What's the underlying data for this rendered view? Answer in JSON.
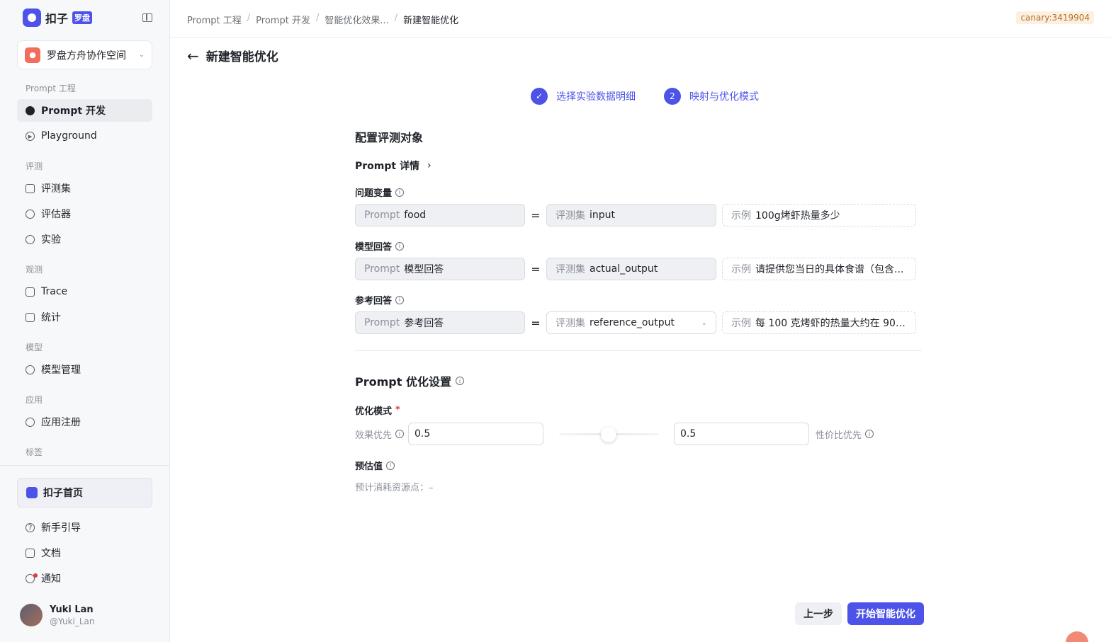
{
  "brand": {
    "name": "扣子",
    "badge": "罗盘"
  },
  "workspace": {
    "name": "罗盘方舟协作空间"
  },
  "sidebar": {
    "groups": [
      {
        "label": "Prompt 工程"
      },
      {
        "label": "评测"
      },
      {
        "label": "观测"
      },
      {
        "label": "模型"
      },
      {
        "label": "应用"
      },
      {
        "label": "标签"
      }
    ],
    "items": [
      {
        "label": "Prompt 开发",
        "icon": "chat-bubble-icon",
        "active": true
      },
      {
        "label": "Playground",
        "icon": "play-circle-icon"
      },
      {
        "label": "评测集",
        "icon": "database-icon"
      },
      {
        "label": "评估器",
        "icon": "bulb-icon"
      },
      {
        "label": "实验",
        "icon": "gauge-icon"
      },
      {
        "label": "Trace",
        "icon": "trace-icon"
      },
      {
        "label": "统计",
        "icon": "chart-icon"
      },
      {
        "label": "模型管理",
        "icon": "cube-icon"
      },
      {
        "label": "应用注册",
        "icon": "box-icon"
      }
    ],
    "home": "扣子首页",
    "footer": [
      {
        "label": "新手引导",
        "icon": "question-icon"
      },
      {
        "label": "文档",
        "icon": "document-icon"
      },
      {
        "label": "通知",
        "icon": "bell-icon"
      }
    ],
    "user": {
      "name": "Yuki Lan",
      "handle": "@Yuki_Lan"
    }
  },
  "breadcrumb": [
    "Prompt 工程",
    "Prompt 开发",
    "智能优化效果...",
    "新建智能优化"
  ],
  "env_badge": "canary:3419904",
  "page_title": "新建智能优化",
  "steps": [
    {
      "label": "选择实验数据明细",
      "state": "done"
    },
    {
      "number": "2",
      "label": "映射与优化模式",
      "state": "current"
    }
  ],
  "config": {
    "title": "配置评测对象",
    "prompt_detail": "Prompt 详情",
    "rows": [
      {
        "label": "问题变量",
        "left_prefix": "Prompt",
        "left_value": "food",
        "mid_prefix": "评测集",
        "mid_value": "input",
        "example_prefix": "示例",
        "example_value": "100g烤虾热量多少"
      },
      {
        "label": "模型回答",
        "left_prefix": "Prompt",
        "left_value": "模型回答",
        "mid_prefix": "评测集",
        "mid_value": "actual_output",
        "example_prefix": "示例",
        "example_value": "请提供您当日的具体食谱（包含..."
      },
      {
        "label": "参考回答",
        "left_prefix": "Prompt",
        "left_value": "参考回答",
        "mid_prefix": "评测集",
        "mid_value": "reference_output",
        "example_prefix": "示例",
        "example_value": "每 100 克烤虾的热量大约在 90 ..."
      }
    ],
    "eq": "="
  },
  "optimize": {
    "title": "Prompt 优化设置",
    "mode_label": "优化模式",
    "required_mark": "*",
    "left_label": "效果优先",
    "left_value": "0.5",
    "right_value": "0.5",
    "right_label": "性价比优先",
    "slider_fraction": 0.5,
    "estimate_label": "预估值",
    "estimate_text": "预计消耗资源点：–"
  },
  "actions": {
    "prev": "上一步",
    "start": "开始智能优化"
  },
  "colors": {
    "accent": "#4d53e8",
    "sidebar_bg": "#f7f8fa",
    "required": "#e5393b"
  }
}
